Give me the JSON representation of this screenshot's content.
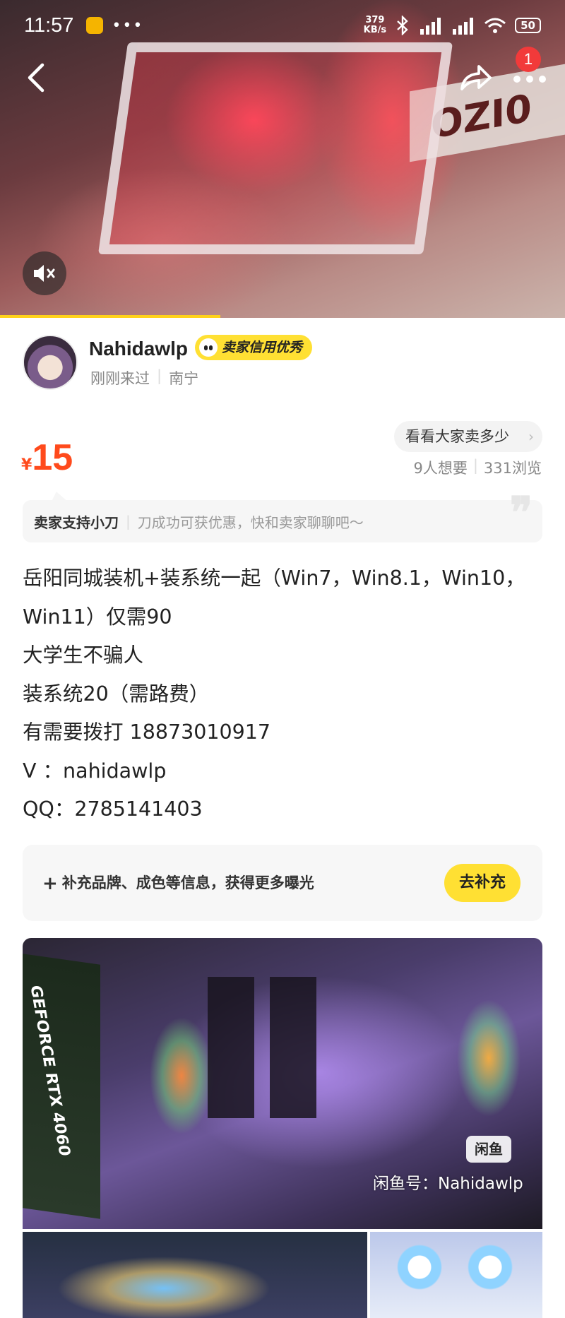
{
  "status_bar": {
    "time": "11:57",
    "dots": "•••",
    "net_speed_value": "379",
    "net_speed_unit": "KB/s",
    "battery": "50"
  },
  "nav": {
    "more_badge": "1"
  },
  "seller": {
    "name": "Nahidawlp",
    "credit_badge": "卖家信用优秀",
    "last_seen": "刚刚来过",
    "location": "南宁"
  },
  "price": {
    "currency": "¥",
    "value": "15"
  },
  "compare_button": "看看大家卖多少",
  "stats": {
    "wants": "9人想要",
    "views": "331浏览"
  },
  "bargain": {
    "title": "卖家支持小刀",
    "text": "刀成功可获优惠，快和卖家聊聊吧～"
  },
  "description": [
    "岳阳同城装机+装系统一起（Win7，Win8.1，Win10，",
    "Win11）仅需90",
    "大学生不骗人",
    "装系统20（需路费）",
    "有需要拨打 18873010917",
    "V   ：nahidawlp",
    "QQ：2785141403"
  ],
  "supplement": {
    "text": "补充品牌、成色等信息，获得更多曝光",
    "button": "去补充"
  },
  "gallery": {
    "box_text": "GEFORCE RTX 4060",
    "watermark_logo": "闲鱼",
    "watermark_text": "闲鱼号：Nahidawlp"
  },
  "colors": {
    "accent_yellow": "#ffe033",
    "price_orange": "#ff4a1c",
    "badge_red": "#f23a3a"
  },
  "video": {
    "progress": 0.39
  }
}
